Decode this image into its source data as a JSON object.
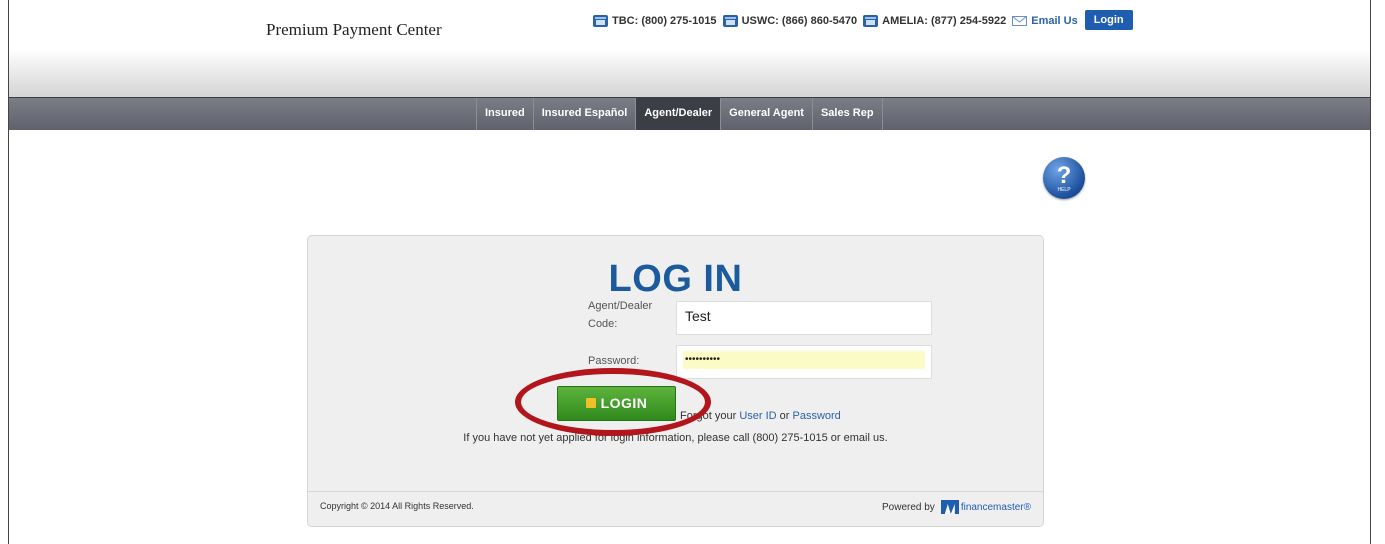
{
  "brand": "Premium Payment Center",
  "topbar": {
    "phones": [
      {
        "label": "TBC: (800) 275-1015"
      },
      {
        "label": "USWC: (866) 860-5470"
      },
      {
        "label": "AMELIA: (877) 254-5922"
      }
    ],
    "email_label": "Email Us",
    "login_label": "Login"
  },
  "nav": {
    "items": [
      "Insured",
      "Insured Español",
      "Agent/Dealer",
      "General Agent",
      "Sales Rep"
    ],
    "active": "Agent/Dealer"
  },
  "help": {
    "symbol": "?",
    "text": "HELP"
  },
  "login_form": {
    "title": "LOG IN",
    "code_label_line1": "Agent/Dealer",
    "code_label_line2": "Code:",
    "code_value": "Test",
    "password_label": "Password:",
    "password_value": "••••••••••",
    "login_button": "LOGIN",
    "forgot_prefix": "Forgot your",
    "forgot_user_id": "User ID",
    "forgot_or": "or",
    "forgot_password": "Password",
    "notice_prefix": "If you have not yet applied for login information, please call (800) 275-1015 or",
    "notice_link": "email us."
  },
  "footer": {
    "copyright": "Copyright © 2014 All Rights Reserved.",
    "powered_by": "Powered by",
    "vendor": "financemaster®"
  },
  "colors": {
    "accent": "#1b5a9c",
    "nav_bg": "#6b6e78",
    "login_button": "#3c9b25",
    "highlight_oval": "#b3151c"
  }
}
